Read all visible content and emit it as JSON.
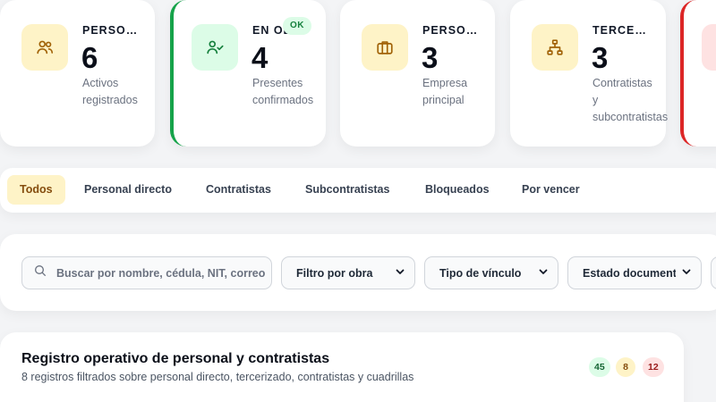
{
  "stats": [
    {
      "label": "PERSO…",
      "value": "6",
      "desc": "Activos registrados",
      "icon": "users-icon"
    },
    {
      "label": "EN OB…",
      "value": "4",
      "desc": "Presentes confirmados",
      "icon": "user-check-icon",
      "badge": "OK"
    },
    {
      "label": "PERSO…",
      "value": "3",
      "desc": "Empresa principal",
      "icon": "briefcase-icon"
    },
    {
      "label": "TERCE…",
      "value": "3",
      "desc": "Contratistas y subcontratistas",
      "icon": "org-chart-icon"
    }
  ],
  "tabs": [
    {
      "label": "Todos",
      "active": true
    },
    {
      "label": "Personal directo"
    },
    {
      "label": "Contratistas"
    },
    {
      "label": "Subcontratistas"
    },
    {
      "label": "Bloqueados"
    },
    {
      "label": "Por vencer"
    }
  ],
  "filters": {
    "search_placeholder": "Buscar por nombre, cédula, NIT, correo",
    "obra": "Filtro por obra",
    "vinculo": "Tipo de vínculo",
    "estado": "Estado documental"
  },
  "registro": {
    "title": "Registro operativo de personal y contratistas",
    "subtitle": "8 registros filtrados sobre personal directo, tercerizado, contratistas y cuadrillas",
    "pills": [
      "45",
      "8",
      "12"
    ]
  },
  "colors": {
    "accent_yellow": "#fef3c7",
    "success": "#16a34a",
    "danger": "#dc2626"
  }
}
